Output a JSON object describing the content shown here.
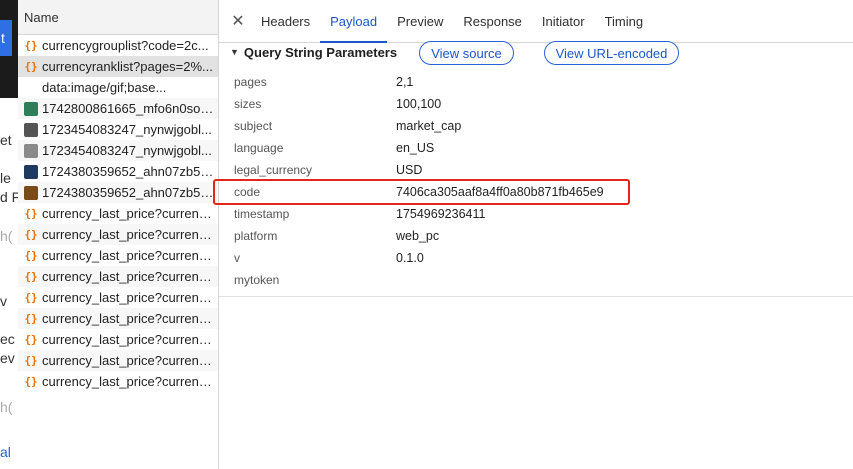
{
  "page_fragments": [
    {
      "text": "et",
      "color": "#333333"
    },
    {
      "text": "le",
      "color": "#333333"
    },
    {
      "text": "d F",
      "color": "#333333"
    },
    {
      "text": "h(",
      "color": "#aaaaaa"
    },
    {
      "text": "v",
      "color": "#333333"
    },
    {
      "text": "ec",
      "color": "#333333"
    },
    {
      "text": "ev",
      "color": "#333333"
    },
    {
      "text": "h(",
      "color": "#aaaaaa"
    },
    {
      "text": "al",
      "color": "#2a62d9"
    }
  ],
  "request_list": {
    "header": "Name",
    "items": [
      {
        "label": "currencygrouplist?code=2c...",
        "icon": "xhr-icon",
        "state": "normal"
      },
      {
        "label": "currencyranklist?pages=2%...",
        "icon": "xhr-icon",
        "state": "selected"
      },
      {
        "label": "data:image/gif;base...",
        "icon": "none",
        "state": "normal"
      },
      {
        "label": "1742800861665_mfo6n0soq...",
        "icon": "image-icon",
        "state": "alt"
      },
      {
        "label": "1723454083247_nynwjgobl...",
        "icon": "image-icon",
        "state": "normal"
      },
      {
        "label": "1723454083247_nynwjgobl...",
        "icon": "image-icon",
        "state": "alt"
      },
      {
        "label": "1724380359652_ahn07zb56...",
        "icon": "image-icon",
        "state": "normal"
      },
      {
        "label": "1724380359652_ahn07zb56...",
        "icon": "image-icon",
        "state": "alt"
      },
      {
        "label": "currency_last_price?currenc...",
        "icon": "xhr-icon",
        "state": "normal"
      },
      {
        "label": "currency_last_price?currenc...",
        "icon": "xhr-icon",
        "state": "alt"
      },
      {
        "label": "currency_last_price?currenc...",
        "icon": "xhr-icon",
        "state": "normal"
      },
      {
        "label": "currency_last_price?currenc...",
        "icon": "xhr-icon",
        "state": "alt"
      },
      {
        "label": "currency_last_price?currenc...",
        "icon": "xhr-icon",
        "state": "normal"
      },
      {
        "label": "currency_last_price?currenc...",
        "icon": "xhr-icon",
        "state": "alt"
      },
      {
        "label": "currency_last_price?currenc...",
        "icon": "xhr-icon",
        "state": "normal"
      },
      {
        "label": "currency_last_price?currenc...",
        "icon": "xhr-icon",
        "state": "alt"
      },
      {
        "label": "currency_last_price?currenc...",
        "icon": "xhr-icon",
        "state": "normal"
      }
    ]
  },
  "tabs": {
    "close_glyph": "✕",
    "items": [
      {
        "label": "Headers",
        "active": false
      },
      {
        "label": "Payload",
        "active": true
      },
      {
        "label": "Preview",
        "active": false
      },
      {
        "label": "Response",
        "active": false
      },
      {
        "label": "Initiator",
        "active": false
      },
      {
        "label": "Timing",
        "active": false
      }
    ]
  },
  "payload": {
    "caret": "▼",
    "section_title": "Query String Parameters",
    "view_source_label": "View source",
    "view_url_encoded_label": "View URL-encoded",
    "params": [
      {
        "key": "pages",
        "value": "2,1"
      },
      {
        "key": "sizes",
        "value": "100,100"
      },
      {
        "key": "subject",
        "value": "market_cap"
      },
      {
        "key": "language",
        "value": "en_US"
      },
      {
        "key": "legal_currency",
        "value": "USD"
      },
      {
        "key": "code",
        "value": "7406ca305aaf8a4ff0a80b871fb465e9"
      },
      {
        "key": "timestamp",
        "value": "1754969236411"
      },
      {
        "key": "platform",
        "value": "web_pc"
      },
      {
        "key": "v",
        "value": "0.1.0"
      },
      {
        "key": "mytoken",
        "value": ""
      }
    ]
  },
  "colors": {
    "accent": "#1a56c9",
    "highlight_box": "#e3261d",
    "xhr_icon": "#e8710a"
  }
}
